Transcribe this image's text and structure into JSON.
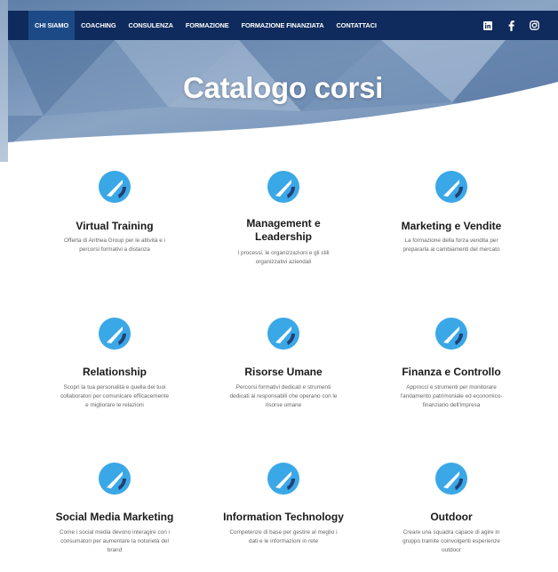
{
  "nav": {
    "items": [
      "CHI SIAMO",
      "COACHING",
      "CONSULENZA",
      "FORMAZIONE",
      "FORMAZIONE FINANZIATA",
      "CONTATTACI"
    ],
    "active_index": 0,
    "socials": [
      "linkedin-icon",
      "facebook-icon",
      "instagram-icon"
    ]
  },
  "hero": {
    "title": "Catalogo corsi"
  },
  "colors": {
    "nav_bg": "#0f2a5c",
    "nav_active": "#1c4a86",
    "icon_blue": "#3aa8e6",
    "icon_navy": "#243e74"
  },
  "courses": [
    {
      "title": "Virtual Training",
      "desc": [
        "Offerta di Anthea Group per le attività e i",
        "percorsi formativi a distanza"
      ]
    },
    {
      "title": "Management e Leadership",
      "title_lines": [
        "Management e",
        "Leadership"
      ],
      "desc": [
        "I processi, le organizzazioni e gli stili",
        "organizzativi aziendali"
      ]
    },
    {
      "title": "Marketing e Vendite",
      "desc": [
        "La formazione della forza vendita per",
        "prepararla ai cambiamenti del mercato"
      ]
    },
    {
      "title": "Relationship",
      "desc": [
        "Scopri la tua personalità e quella dei tuoi",
        "collaboratori per comunicare efficacemente",
        "e migliorare le relazioni"
      ]
    },
    {
      "title": "Risorse Umane",
      "desc": [
        "Percorsi formativi dedicati e strumenti",
        "dedicati ai responsabili che operano con le",
        "risorse umane"
      ]
    },
    {
      "title": "Finanza e Controllo",
      "desc": [
        "Approcci e strumenti per monitorare",
        "l'andamento patrimoniale ed economico-",
        "finanziario dell'impresa"
      ]
    },
    {
      "title": "Social Media Marketing",
      "desc": [
        "Come i social media devono interagire con i",
        "consumatori per aumentare la notorietà del",
        "brand"
      ]
    },
    {
      "title": "Information Technology",
      "desc": [
        "Competenze di base per gestire al meglio i",
        "dati e le informazioni in rete"
      ]
    },
    {
      "title": "Outdoor",
      "desc": [
        "Creare una squadra capace di agire in",
        "gruppo tramite coinvolgenti esperienze",
        "outdoor"
      ]
    }
  ]
}
